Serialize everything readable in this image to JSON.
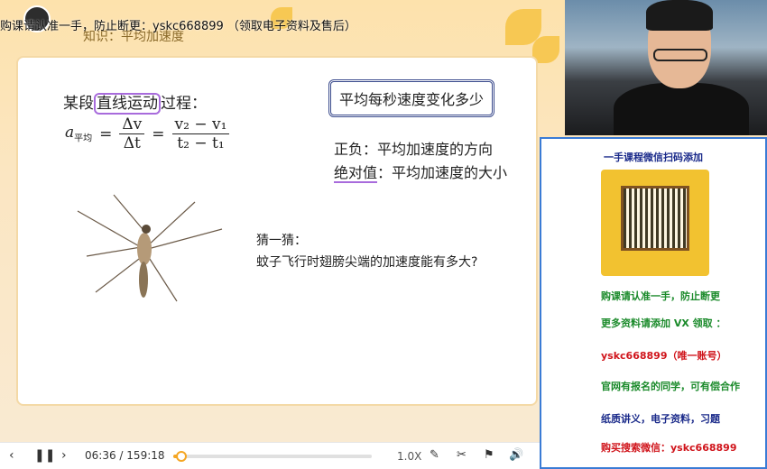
{
  "watermark": {
    "text": "购课请认准一手，防止断更：yskc668899  （领取电子资料及售后）"
  },
  "slide": {
    "title": "知识：平均加速度",
    "segment_prefix": "某段",
    "segment_highlight": "直线运动",
    "segment_suffix": "过程：",
    "formula": {
      "lhs": "a",
      "lhs_sub": "平均",
      "eq": "=",
      "f1_num": "Δv",
      "f1_den": "Δt",
      "eq2": "=",
      "f2_num": "v₂ − v₁",
      "f2_den": "t₂ − t₁"
    },
    "boxed_question": "平均每秒速度变化多少",
    "line1": "正负：平均加速度的方向",
    "line2_prefix": "绝对值",
    "line2_suffix": "：平均加速度的大小",
    "guess_label": "猜一猜：",
    "guess_question": "蚊子飞行时翅膀尖端的加速度能有多大?"
  },
  "ad": {
    "title": "一手课程微信扫码添加",
    "lines": [
      {
        "text": "购课请认准一手，防止断更",
        "color": "#1a8a2a"
      },
      {
        "text": "更多资料请添加 VX 领取 ：",
        "color": "#1a8a2a"
      },
      {
        "text": "yskc668899（唯一账号）",
        "color": "#d0141b"
      },
      {
        "text": "官网有报名的同学，可有偿合作",
        "color": "#1a8a2a"
      },
      {
        "text": "纸质讲义，电子资料，习题",
        "color": "#1a2a8a"
      },
      {
        "text": "购买搜索微信：yskc668899",
        "color": "#d0141b"
      }
    ]
  },
  "player": {
    "current": "06:36",
    "sep": "/",
    "total": "159:18",
    "progress": 0.04,
    "speed": "1.0X"
  },
  "colors": {
    "accent": "#f5a623",
    "highlight": "#a86bdc",
    "panel_border": "#3a7bd5"
  }
}
